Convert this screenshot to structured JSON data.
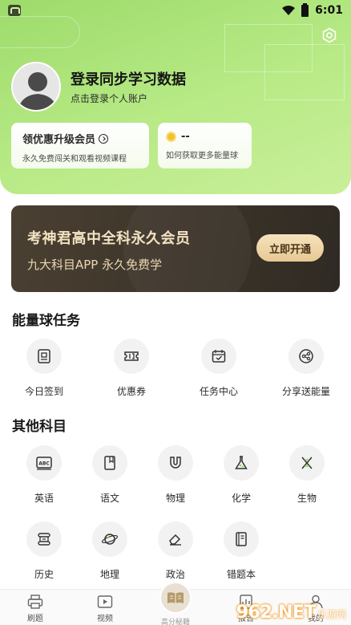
{
  "status_bar": {
    "time": "6:01"
  },
  "profile": {
    "title": "登录同步学习数据",
    "subtitle": "点击登录个人账户"
  },
  "vip_card": {
    "title": "领优惠升级会员",
    "subtitle": "永久免费闯关和观看视频课程"
  },
  "energy_card": {
    "value": "--",
    "subtitle": "如何获取更多能量球"
  },
  "banner": {
    "title": "考神君高中全科永久会员",
    "subtitle": "九大科目APP 永久免费学",
    "button": "立即开通"
  },
  "tasks": {
    "title": "能量球任务",
    "items": [
      {
        "label": "今日签到",
        "icon": "calendar-check-icon"
      },
      {
        "label": "优惠券",
        "icon": "ticket-icon"
      },
      {
        "label": "任务中心",
        "icon": "task-calendar-icon"
      },
      {
        "label": "分享送能量",
        "icon": "share-icon"
      }
    ]
  },
  "subjects": {
    "title": "其他科目",
    "items": [
      {
        "label": "英语",
        "icon": "abc-book-icon"
      },
      {
        "label": "语文",
        "icon": "notebook-icon"
      },
      {
        "label": "物理",
        "icon": "magnet-icon"
      },
      {
        "label": "化学",
        "icon": "flask-icon"
      },
      {
        "label": "生物",
        "icon": "dna-icon"
      },
      {
        "label": "历史",
        "icon": "scroll-icon"
      },
      {
        "label": "地理",
        "icon": "planet-icon"
      },
      {
        "label": "政治",
        "icon": "eraser-icon"
      },
      {
        "label": "错题本",
        "icon": "mistake-book-icon"
      }
    ]
  },
  "bottom_nav": {
    "items": [
      {
        "label": "刷题"
      },
      {
        "label": "视频"
      },
      {
        "label": "高分秘籍"
      },
      {
        "label": "报告"
      },
      {
        "label": "我的"
      }
    ]
  },
  "watermark": {
    "main": "962.NET",
    "sub": "乐游网"
  },
  "colors": {
    "accent_green": "#9ddb6b",
    "banner_dark": "#3b3329",
    "banner_gold": "#f3e2c2"
  }
}
